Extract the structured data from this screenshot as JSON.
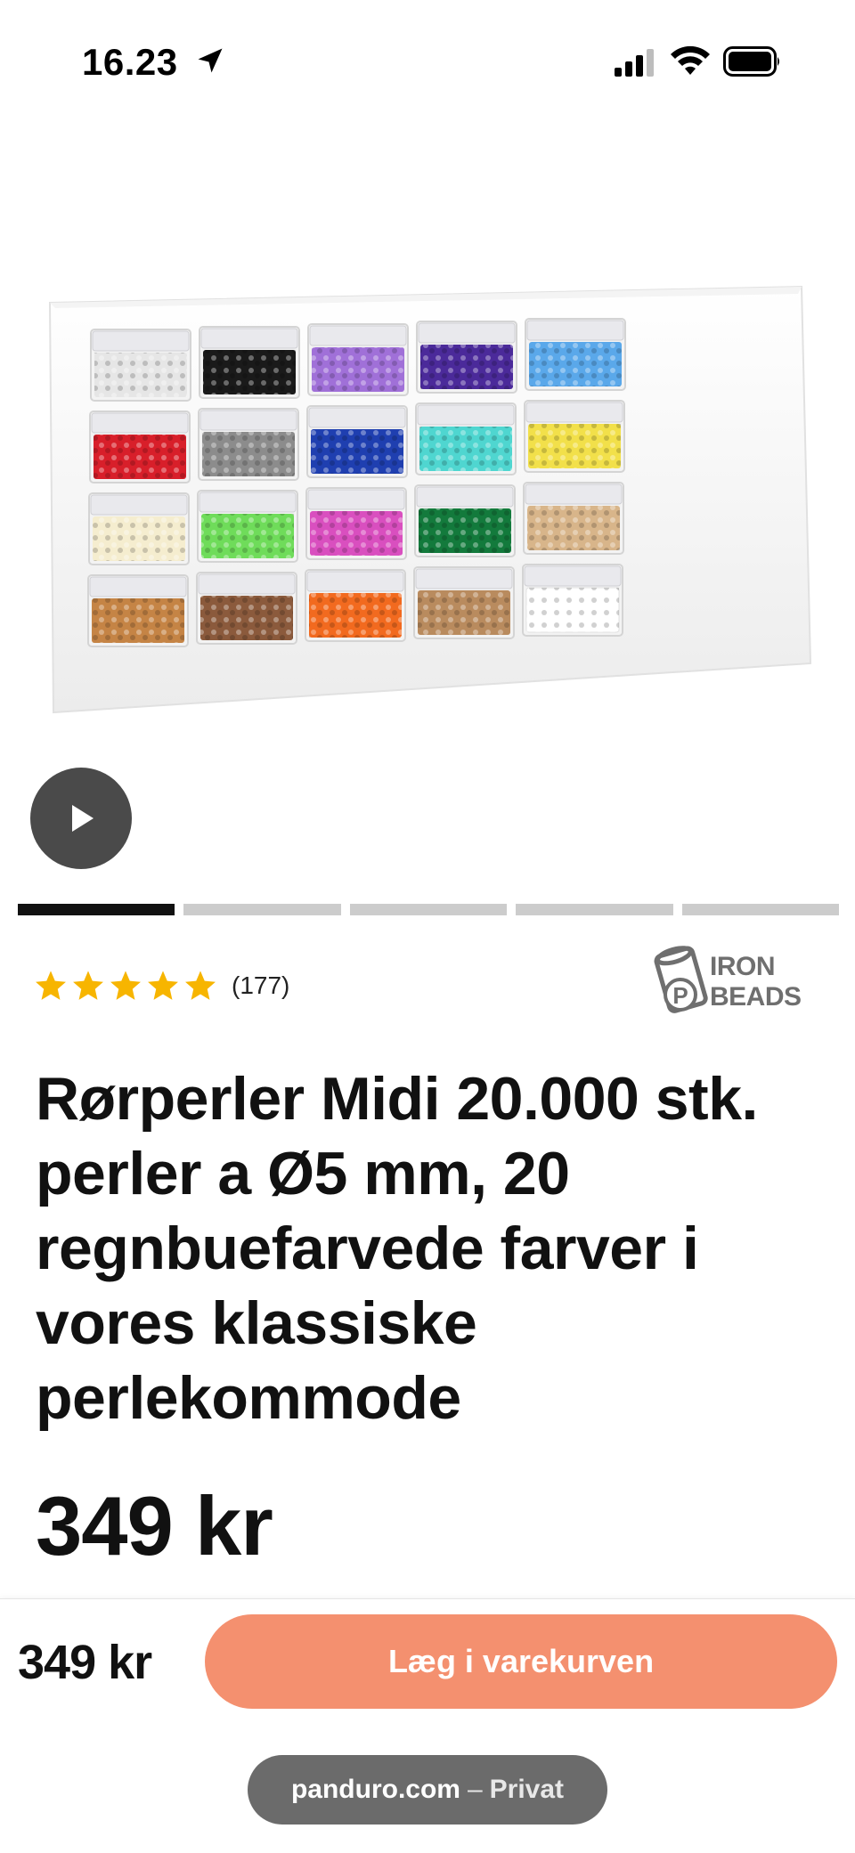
{
  "status_bar": {
    "time": "16.23",
    "icons": [
      "location-arrow-icon",
      "cellular-signal-icon",
      "wifi-icon",
      "battery-icon"
    ]
  },
  "product": {
    "image_alt_colors": [
      [
        "#e6e6e6",
        "#1a1a1a",
        "#a070d8",
        "#4b2a9a",
        "#5aa8ea"
      ],
      [
        "#d81f2a",
        "#8c8c8c",
        "#1f3fb0",
        "#4fd6d0",
        "#f2e04a"
      ],
      [
        "#f5edcf",
        "#6fdc5a",
        "#d94fbf",
        "#137a3c",
        "#d8b58a"
      ],
      [
        "#c58445",
        "#8b5a3c",
        "#f26a1f",
        "#b98b5e",
        "#ffffff"
      ]
    ],
    "rating_stars": 5,
    "rating_count": "(177)",
    "brand_logo_lines": [
      "IRON",
      "BEADS"
    ],
    "title": "Rørperler Midi 20.000 stk. perler a Ø5 mm, 20 regnbuefarvede farver i vores klassiske perlekommode",
    "price": "349 kr"
  },
  "carousel": {
    "slides": 5,
    "active_index": 0
  },
  "buy_bar": {
    "price": "349 kr",
    "add_to_cart_label": "Læg i varekurven"
  },
  "browser": {
    "domain": "panduro.com",
    "separator": "–",
    "mode": "Privat"
  },
  "colors": {
    "accent_button": "#f4906f",
    "star": "#f7b500",
    "play_button": "#4a4a4a"
  }
}
